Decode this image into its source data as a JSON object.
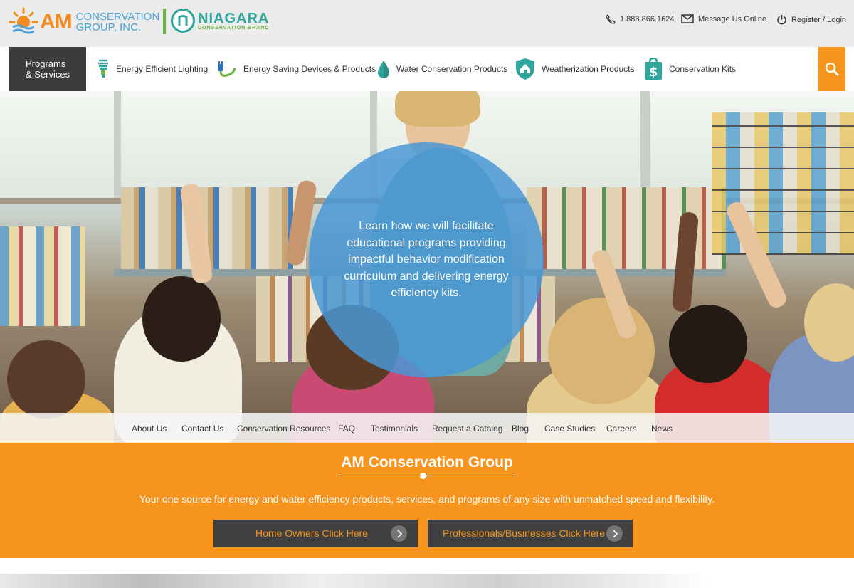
{
  "header": {
    "brand_am": "AM",
    "brand_am_sub_line1": "CONSERVATION",
    "brand_am_sub_line2": "GROUP, INC.",
    "brand_niagara": "NIAGARA",
    "brand_niagara_sub": "CONSERVATION BRAND",
    "phone": "1.888.866.1624",
    "message_label": "Message Us Online",
    "register_label": "Register / Login"
  },
  "nav": {
    "programs_line1": "Programs",
    "programs_line2": "& Services",
    "items": [
      {
        "label": "Energy Efficient Lighting",
        "icon": "lightbulb-icon"
      },
      {
        "label": "Energy Saving Devices & Products",
        "icon": "plug-icon"
      },
      {
        "label": "Water Conservation Products",
        "icon": "water-drop-icon"
      },
      {
        "label": "Weatherization Products",
        "icon": "house-shield-icon"
      },
      {
        "label": "Conservation Kits",
        "icon": "kit-bag-icon"
      }
    ]
  },
  "hero": {
    "text": "Learn how we will facilitate educational programs providing impactful behavior modification curriculum and delivering energy efficiency kits."
  },
  "subnav": {
    "items": [
      "About Us",
      "Contact Us",
      "Conservation Resources",
      "FAQ",
      "Testimonials",
      "Request a Catalog",
      "Blog",
      "Case Studies",
      "Careers",
      "News"
    ]
  },
  "band": {
    "title": "AM Conservation Group",
    "description": "Your one source for energy and water efficiency products, services, and programs of any size with unmatched speed and flexibility.",
    "cta_home": "Home Owners Click Here",
    "cta_pro": "Professionals/Businesses Click Here"
  },
  "colors": {
    "accent_orange": "#f7941d",
    "nav_dark": "#3c3c3c",
    "hero_circle_blue": "#4998d6"
  }
}
